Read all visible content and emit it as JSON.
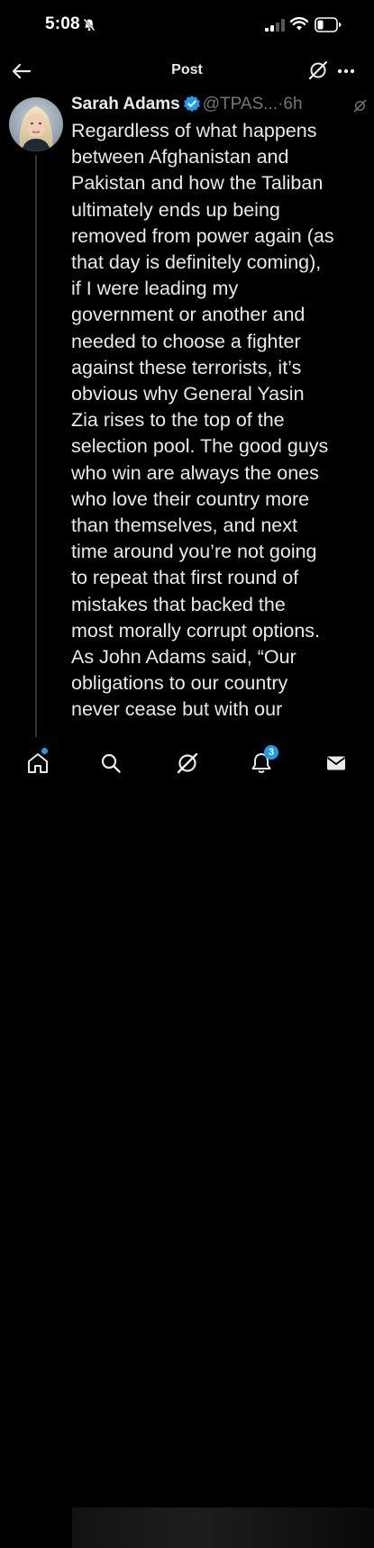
{
  "status_bar": {
    "time": "5:08"
  },
  "header": {
    "title": "Post"
  },
  "post": {
    "author_name": "Sarah Adams",
    "handle": "@TPAS...",
    "separator": "·",
    "time_ago": "6h",
    "text": "Regardless of what happens\nbetween Afghanistan and\nPakistan and how the Taliban\nultimately ends up being\nremoved from power again (as\nthat day is definitely coming),\nif I were leading my\ngovernment or another and\nneeded to choose a fighter\nagainst these terrorists, it’s\nobvious why General Yasin\nZia rises to the top of the\nselection pool. The good guys\nwho win are always the ones\nwho love their country more\nthan themselves, and next\ntime around you’re not going\nto repeat that first round of\nmistakes that backed the\nmost morally corrupt options.\nAs John Adams said, “Our\nobligations to our country\nnever cease but with our"
  },
  "tab_bar": {
    "notifications_count": "3"
  },
  "colors": {
    "accent": "#1d9bf0",
    "background": "#000000",
    "text": "#e7e9ea",
    "secondary_text": "#71767b"
  }
}
